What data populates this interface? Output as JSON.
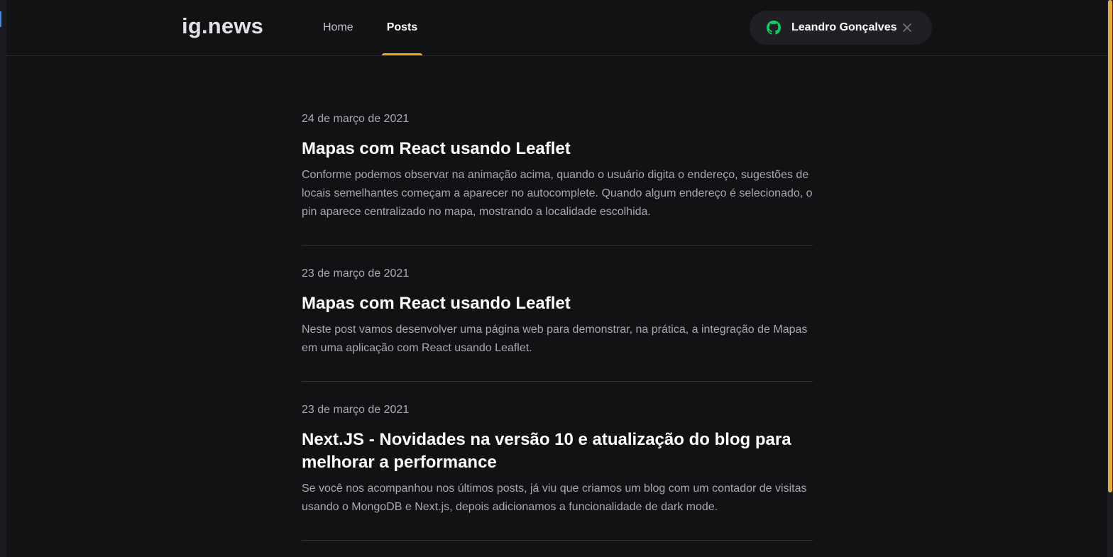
{
  "app": {
    "logo": "ig.news"
  },
  "nav": {
    "home_label": "Home",
    "posts_label": "Posts",
    "active": "Posts"
  },
  "user": {
    "name": "Leandro Gonçalves",
    "github_icon": "github-icon",
    "signout_icon": "close-icon"
  },
  "posts": [
    {
      "date": "24 de março de 2021",
      "title": "Mapas com React usando Leaflet",
      "excerpt": "Conforme podemos observar na animação acima, quando o usuário digita o endereço, sugestões de locais semelhantes começam a aparecer no autocomplete. Quando algum endereço é selecionado, o pin aparece centralizado no mapa, mostrando a localidade escolhida."
    },
    {
      "date": "23 de março de 2021",
      "title": "Mapas com React usando Leaflet",
      "excerpt": "Neste post vamos desenvolver uma página web para demonstrar, na prática, a integração de Mapas em uma aplicação com React usando Leaflet."
    },
    {
      "date": "23 de março de 2021",
      "title": "Next.JS - Novidades na versão 10 e atualização do blog para melhorar a performance",
      "excerpt": "Se você nos acompanhou nos últimos posts, já viu que criamos um blog com um contador de visitas usando o MongoDB e Next.js, depois adicionamos a funcionalidade de dark mode."
    }
  ],
  "colors": {
    "background": "#121214",
    "accent": "#eba417",
    "github_green": "#04d361",
    "text_muted": "#a8a8b3"
  }
}
